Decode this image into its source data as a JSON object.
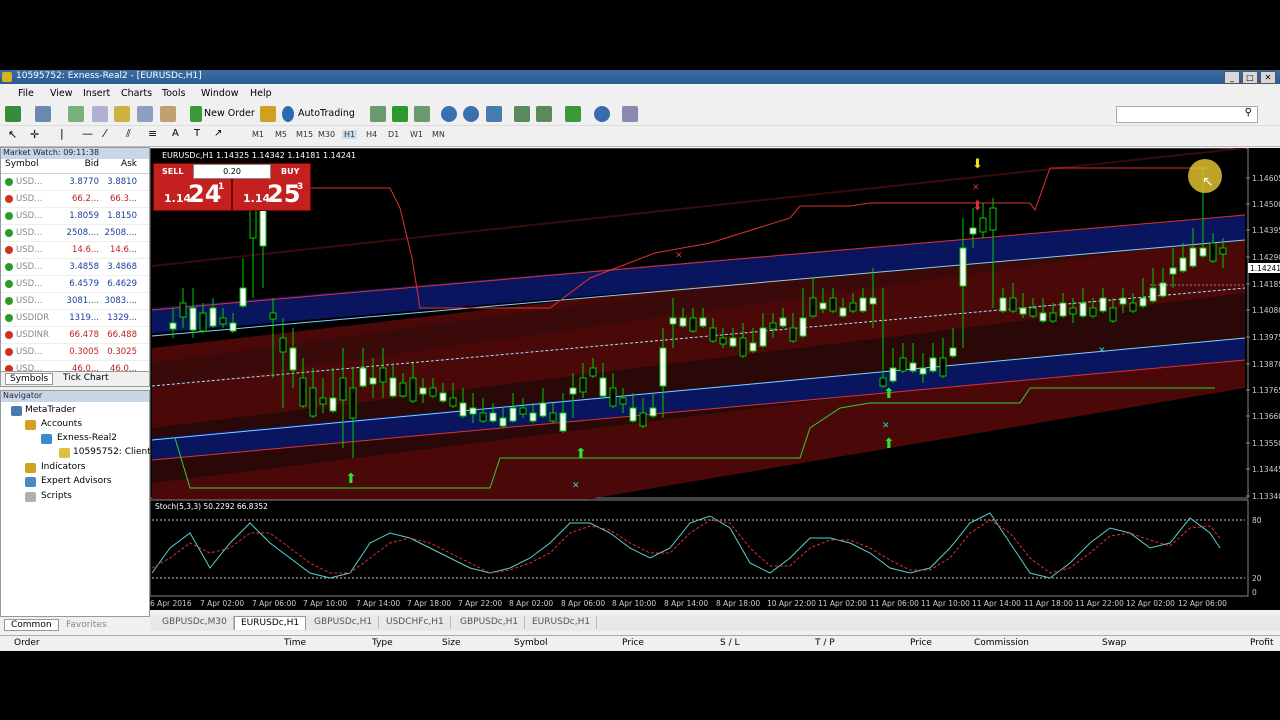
{
  "window": {
    "title": "10595752: Exness-Real2 - [EURUSDc,H1]"
  },
  "menu": [
    "File",
    "View",
    "Insert",
    "Charts",
    "Tools",
    "Window",
    "Help"
  ],
  "toolbar": {
    "new_order": "New Order",
    "autotrading": "AutoTrading"
  },
  "timeframes": [
    "M1",
    "M5",
    "M15",
    "M30",
    "H1",
    "H4",
    "D1",
    "W1",
    "MN"
  ],
  "market_watch": {
    "header": "Market Watch: 09:11:38",
    "cols": {
      "symbol": "Symbol",
      "bid": "Bid",
      "ask": "Ask"
    },
    "rows": [
      {
        "sym": "USD...",
        "bid": "3.8770",
        "ask": "3.8810",
        "dir": "up"
      },
      {
        "sym": "USD...",
        "bid": "66.2...",
        "ask": "66.3...",
        "dir": "dn"
      },
      {
        "sym": "USD...",
        "bid": "1.8059",
        "ask": "1.8150",
        "dir": "up"
      },
      {
        "sym": "USD...",
        "bid": "2508....",
        "ask": "2508....",
        "dir": "up"
      },
      {
        "sym": "USD...",
        "bid": "14.6...",
        "ask": "14.6...",
        "dir": "dn"
      },
      {
        "sym": "USD...",
        "bid": "3.4858",
        "ask": "3.4868",
        "dir": "up"
      },
      {
        "sym": "USD...",
        "bid": "6.4579",
        "ask": "6.4629",
        "dir": "up"
      },
      {
        "sym": "USD...",
        "bid": "3081....",
        "ask": "3083....",
        "dir": "up"
      },
      {
        "sym": "USDIDR",
        "bid": "1319...",
        "ask": "1329...",
        "dir": "up"
      },
      {
        "sym": "USDINR",
        "bid": "66.478",
        "ask": "66.488",
        "dir": "dn"
      },
      {
        "sym": "USD...",
        "bid": "0.3005",
        "ask": "0.3025",
        "dir": "dn"
      },
      {
        "sym": "USD...",
        "bid": "46.0...",
        "ask": "46.0...",
        "dir": "dn"
      }
    ],
    "tabs": [
      "Symbols",
      "Tick Chart"
    ]
  },
  "navigator": {
    "header": "Navigator",
    "items": [
      "MetaTrader",
      "Accounts",
      "Exness-Real2",
      "10595752: Client",
      "Indicators",
      "Expert Advisors",
      "Scripts"
    ],
    "tabs": [
      "Common",
      "Favorites"
    ]
  },
  "chart": {
    "info": "EURUSDc,H1  1.14325 1.14342 1.14181 1.14241",
    "one_click": {
      "sell": "SELL",
      "buy": "BUY",
      "lot": "0.20",
      "sell_big": "1.14",
      "sell_pips": "24",
      "sell_frac": "1",
      "buy_big": "1.14",
      "buy_pips": "25",
      "buy_frac": "3"
    },
    "price_labels": [
      "1.14605",
      "1.14500",
      "1.14395",
      "1.14290",
      "1.14185",
      "1.14080",
      "1.13975",
      "1.13870",
      "1.13765",
      "1.13660",
      "1.13550",
      "1.13445",
      "1.13340"
    ],
    "current_price": "1.14241",
    "stoch_label": "Stoch(5,3,3) 50.2292 66.8352",
    "stoch_levels": [
      "80",
      "20",
      "0"
    ],
    "time_labels": [
      "6 Apr 2016",
      "7 Apr 02:00",
      "7 Apr 06:00",
      "7 Apr 10:00",
      "7 Apr 14:00",
      "7 Apr 18:00",
      "7 Apr 22:00",
      "8 Apr 02:00",
      "8 Apr 06:00",
      "8 Apr 10:00",
      "8 Apr 14:00",
      "8 Apr 18:00",
      "10 Apr 22:00",
      "11 Apr 02:00",
      "11 Apr 06:00",
      "11 Apr 10:00",
      "11 Apr 14:00",
      "11 Apr 18:00",
      "11 Apr 22:00",
      "12 Apr 02:00",
      "12 Apr 06:00"
    ]
  },
  "chart_tabs": [
    "GBPUSDc,M30",
    "EURUSDc,H1",
    "GBPUSDc,H1",
    "USDCHFc,H1",
    "GBPUSDc,H1",
    "EURUSDc,H1"
  ],
  "terminal_cols": [
    "Order",
    "Time",
    "Type",
    "Size",
    "Symbol",
    "Price",
    "S / L",
    "T / P",
    "Price",
    "Commission",
    "Swap",
    "Profit"
  ],
  "colors": {
    "bull": "#ffffff",
    "bear": "#000000",
    "wick": "#00cc00",
    "channel_red": "#5a0a0a",
    "channel_blue": "#0a1a6a"
  }
}
